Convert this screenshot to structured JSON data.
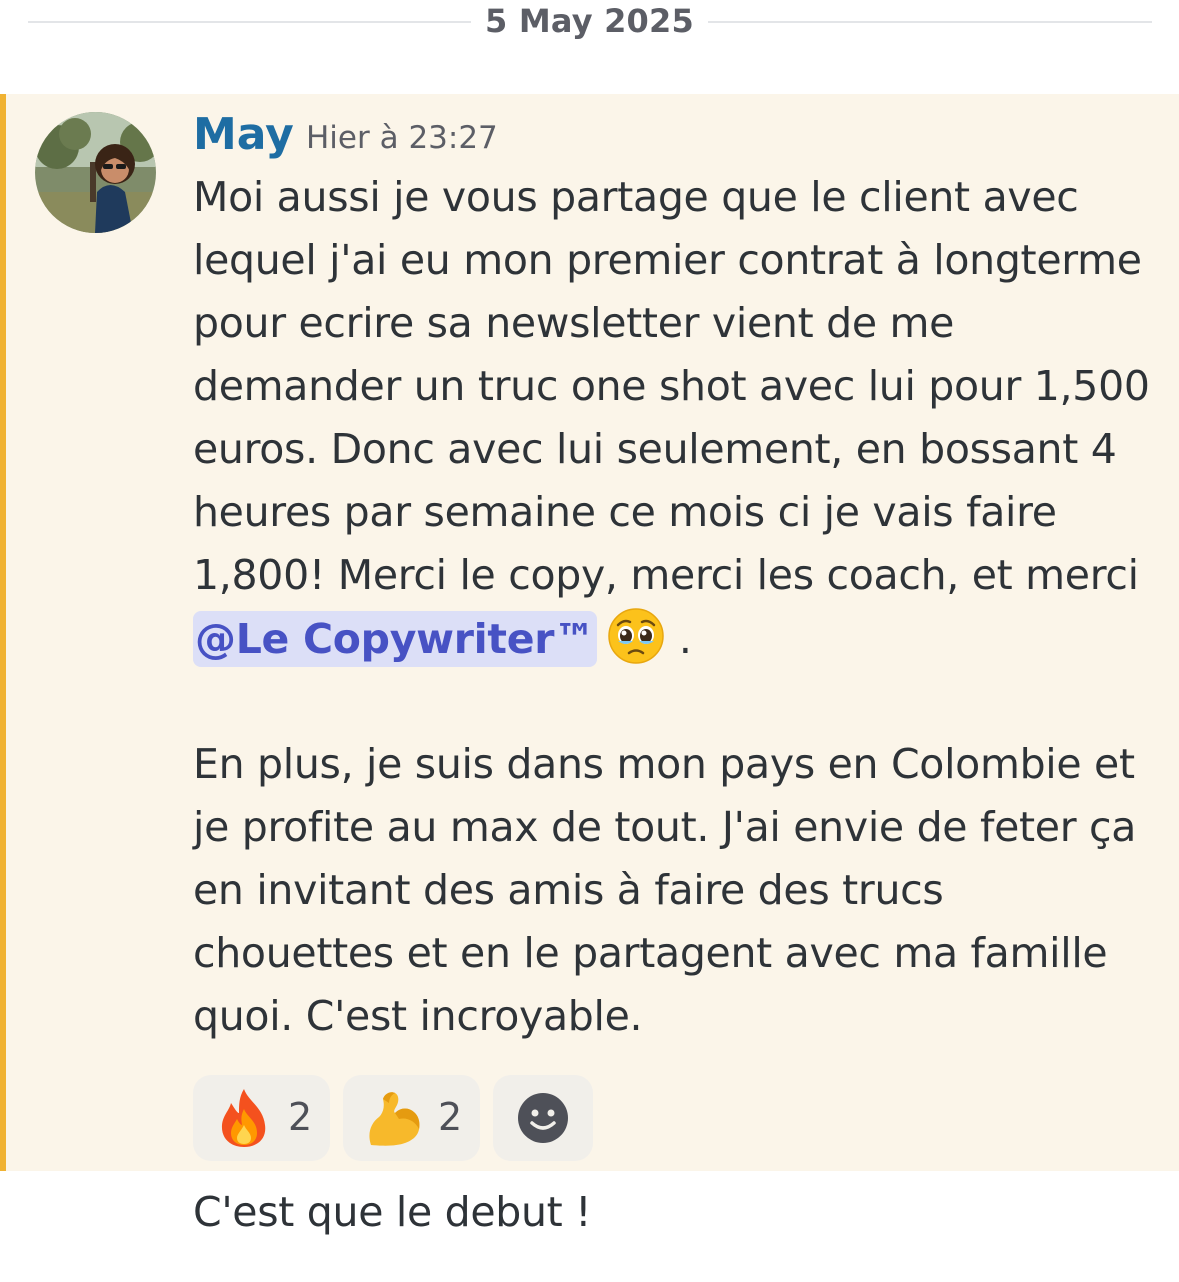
{
  "divider": {
    "date": "5 May 2025"
  },
  "message": {
    "author": "May",
    "timestamp": "Hier à 23:27",
    "lines": [
      "Moi aussi je vous partage que le client avec",
      "lequel j'ai eu mon premier contrat à longterme",
      "pour ecrire sa newsletter vient de me",
      "demander un truc one shot avec lui pour 1,500",
      "euros. Donc avec lui seulement, en bossant 4",
      "heures par semaine ce mois ci je vais faire",
      "1,800! Merci le copy, merci les coach, et merci"
    ],
    "mention": "@Le Copywriter™",
    "mention_suffix": ".",
    "paragraph2": [
      "En plus, je suis dans mon pays en Colombie et",
      "je profite au max de tout. J'ai envie de feter ça",
      "en invitant des amis à faire des trucs",
      "chouettes et en le partagent avec ma famille",
      "quoi. C'est incroyable."
    ],
    "reactions": [
      {
        "icon": "fire-emoji",
        "count": "2"
      },
      {
        "icon": "flexed-biceps-emoji",
        "count": "2"
      },
      {
        "icon": "add-reaction-icon"
      }
    ],
    "colors": {
      "accent": "#f0b232",
      "highlight_bg": "#fbf5e9",
      "author": "#1e6da3",
      "mention": "#4752c4"
    }
  },
  "next_message": {
    "text": "C'est que le debut !"
  }
}
